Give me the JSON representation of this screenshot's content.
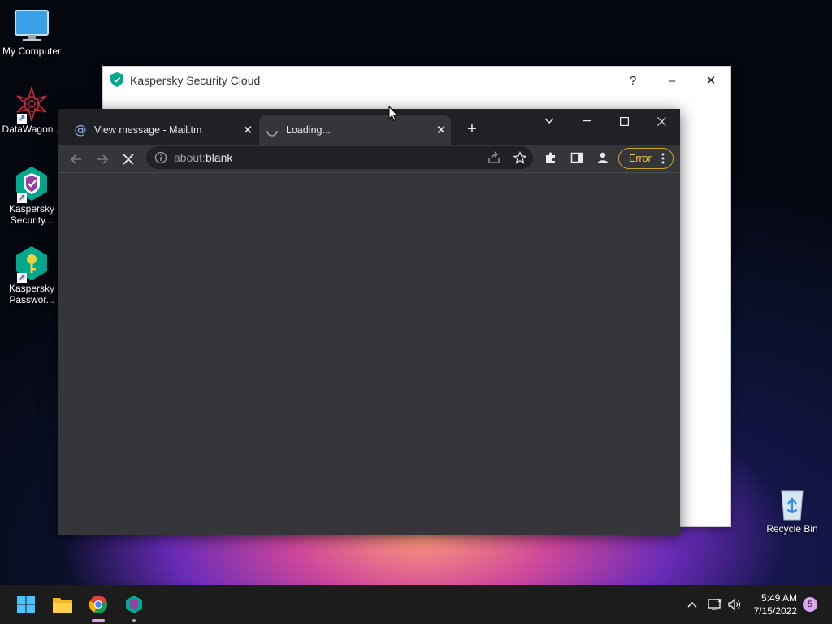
{
  "desktop": {
    "icons": [
      {
        "label": "My Computer"
      },
      {
        "label": "DataWagon..."
      },
      {
        "label": "Kaspersky Security..."
      },
      {
        "label": "Kaspersky Passwor..."
      },
      {
        "label": "Recycle Bin"
      }
    ]
  },
  "kaspersky_window": {
    "title": "Kaspersky Security Cloud",
    "help": "?",
    "minimize": "–",
    "close": "✕"
  },
  "browser": {
    "tabs": [
      {
        "title": "View message - Mail.tm",
        "active": false
      },
      {
        "title": "Loading...",
        "active": true
      }
    ],
    "new_tab": "+",
    "address": {
      "scheme": "about:",
      "host": "blank"
    },
    "error_label": "Error"
  },
  "taskbar": {
    "time": "5:49 AM",
    "date": "7/15/2022",
    "notification_count": "5"
  },
  "colors": {
    "chrome_dark": "#35363a",
    "tabstrip": "#202124",
    "kaspersky_green": "#00a88e",
    "error_yellow": "#f2c94c"
  }
}
